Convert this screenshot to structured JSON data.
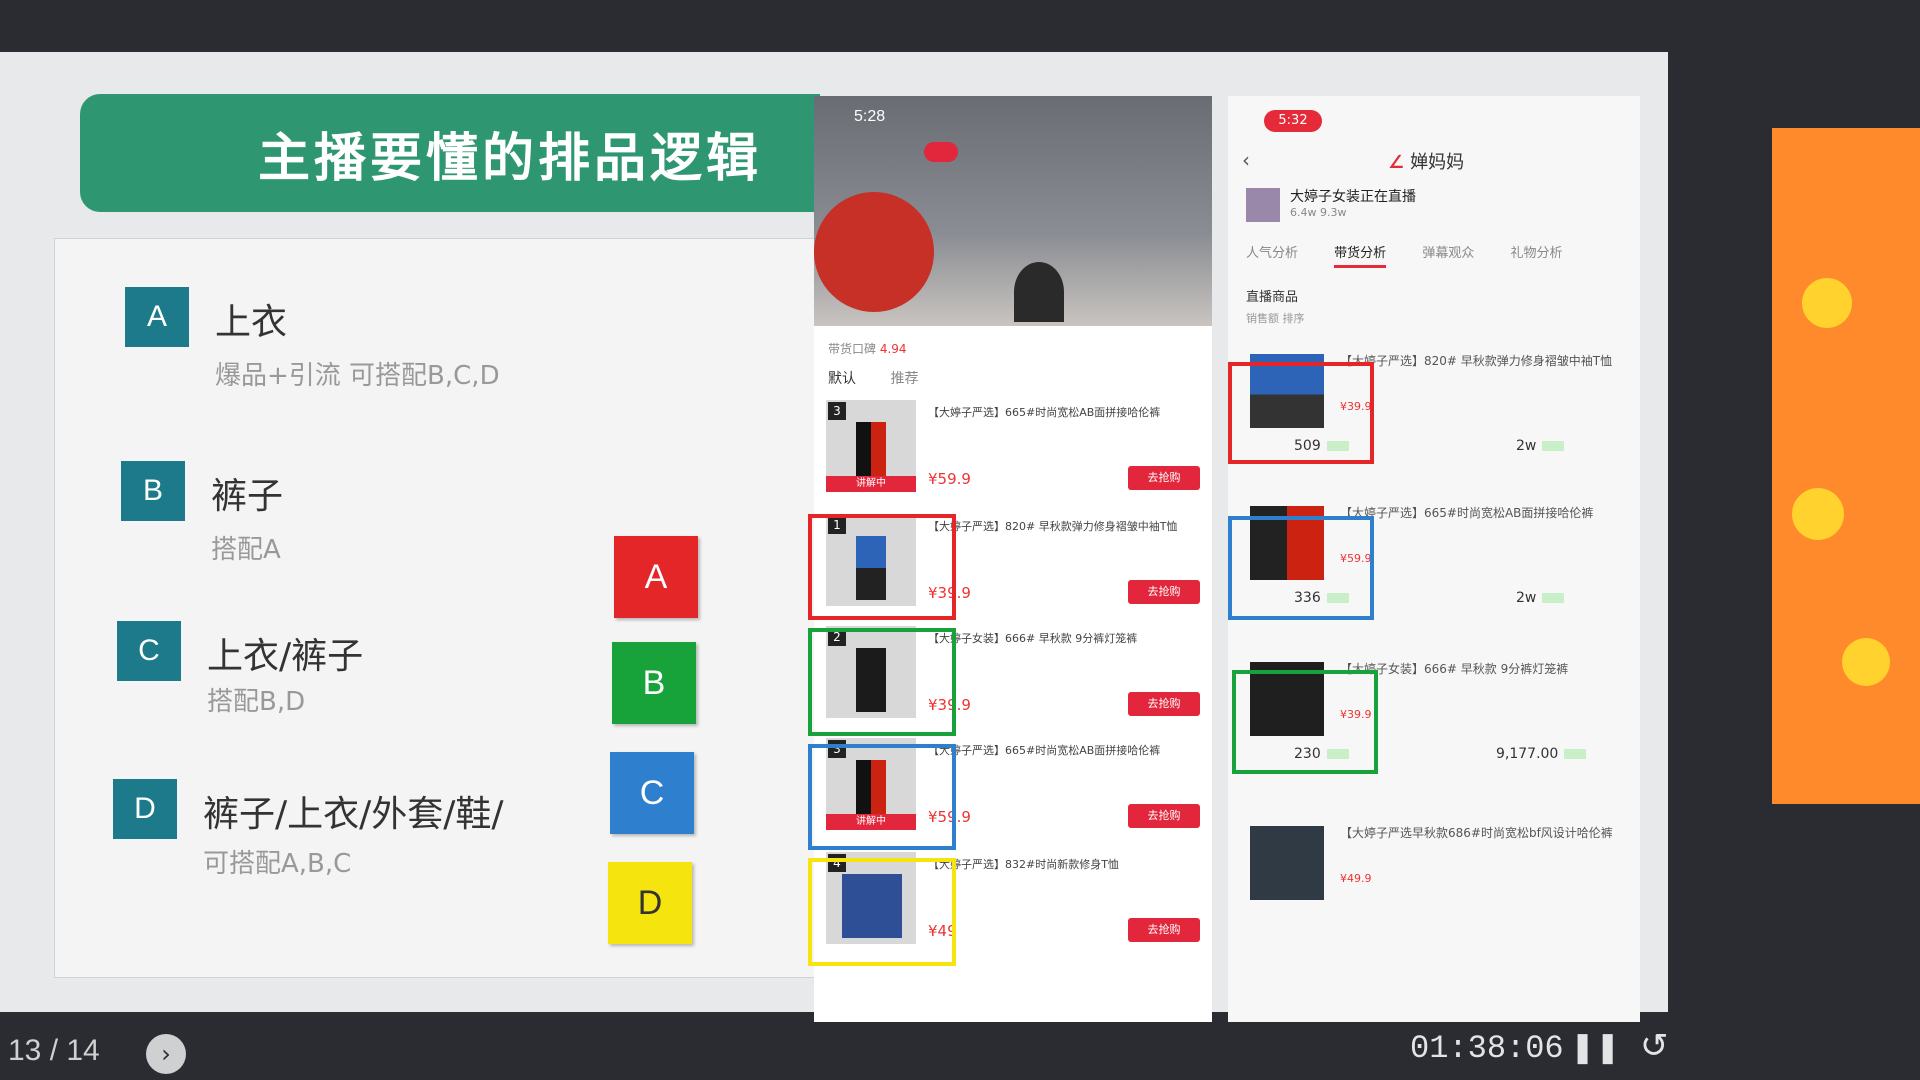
{
  "slide": {
    "title": "主播要懂的排品逻辑",
    "items": [
      {
        "letter": "A",
        "title": "上衣",
        "sub": "爆品+引流  可搭配B,C,D"
      },
      {
        "letter": "B",
        "title": "裤子",
        "sub": "搭配A"
      },
      {
        "letter": "C",
        "title": "上衣/裤子",
        "sub": "搭配B,D"
      },
      {
        "letter": "D",
        "title": "裤子/上衣/外套/鞋/",
        "sub": "可搭配A,B,C"
      }
    ],
    "legend": [
      {
        "label": "A",
        "color": "#e52628"
      },
      {
        "label": "B",
        "color": "#17a339"
      },
      {
        "label": "C",
        "color": "#2f7fcf"
      },
      {
        "label": "D",
        "color": "#f5e40e"
      }
    ]
  },
  "phone1": {
    "time": "5:28",
    "sheet_head_prefix": "带货口碑",
    "sheet_head_score": "4.94",
    "tabs": [
      "默认",
      "推荐"
    ],
    "products": [
      {
        "rank": "3",
        "name": "【大婷子严选】665#时尚宽松AB面拼接哈伦裤",
        "price": "¥59.9",
        "live": "讲解中",
        "buy": "去抢购"
      },
      {
        "rank": "1",
        "name": "【大婷子严选】820# 早秋款弹力修身褶皱中袖T恤",
        "price": "¥39.9",
        "live": "",
        "buy": "去抢购"
      },
      {
        "rank": "2",
        "name": "【大婷子女装】666# 早秋款 9分裤灯笼裤",
        "price": "¥39.9",
        "live": "",
        "buy": "去抢购"
      },
      {
        "rank": "3",
        "name": "【大婷子严选】665#时尚宽松AB面拼接哈伦裤",
        "price": "¥59.9",
        "live": "讲解中",
        "buy": "去抢购"
      },
      {
        "rank": "4",
        "name": "【大婷子严选】832#时尚新款修身T恤",
        "price": "¥49",
        "live": "",
        "buy": "去抢购"
      }
    ],
    "highlight_colors": [
      "#e52628",
      "#17a339",
      "#2f7fcf",
      "#f5e40e"
    ]
  },
  "phone2": {
    "time": "5:32",
    "app_name": "婵妈妈",
    "shop_name": "大婷子女装正在直播",
    "shop_stats": "6.4w       9.3w",
    "tabs": [
      "人气分析",
      "带货分析",
      "弹幕观众",
      "礼物分析"
    ],
    "section": "直播商品",
    "subsection": "销售额 排序",
    "items": [
      {
        "name": "【大婷子严选】820# 早秋款弹力修身褶皱中袖T恤",
        "price": "¥39.9",
        "sales": "509",
        "amount": "2w"
      },
      {
        "name": "【大婷子严选】665#时尚宽松AB面拼接哈伦裤",
        "price": "¥59.9",
        "sales": "336",
        "amount": "2w"
      },
      {
        "name": "【大婷子女装】666# 早秋款 9分裤灯笼裤",
        "price": "¥39.9",
        "sales": "230",
        "amount": "9,177.00"
      },
      {
        "name": "【大婷子严选早秋款686#时尚宽松bf风设计哈伦裤",
        "price": "¥49.9",
        "sales": "",
        "amount": ""
      }
    ]
  },
  "player": {
    "page": "13 / 14",
    "timer": "01:38:06"
  }
}
